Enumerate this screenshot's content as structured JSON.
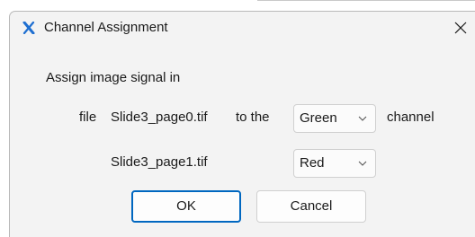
{
  "dialog": {
    "title": "Channel Assignment",
    "instruction": "Assign image signal in",
    "file_label": "file",
    "to_the_label": "to the",
    "channel_label": "channel",
    "rows": [
      {
        "filename": "Slide3_page0.tif",
        "channel": "Green"
      },
      {
        "filename": "Slide3_page1.tif",
        "channel": "Red"
      }
    ],
    "ok_label": "OK",
    "cancel_label": "Cancel"
  },
  "icons": {
    "app": "x-logo-icon",
    "close": "close-icon",
    "dropdown": "chevron-down-icon"
  },
  "colors": {
    "accent": "#0067c0",
    "app_icon": "#1f6fd1"
  }
}
